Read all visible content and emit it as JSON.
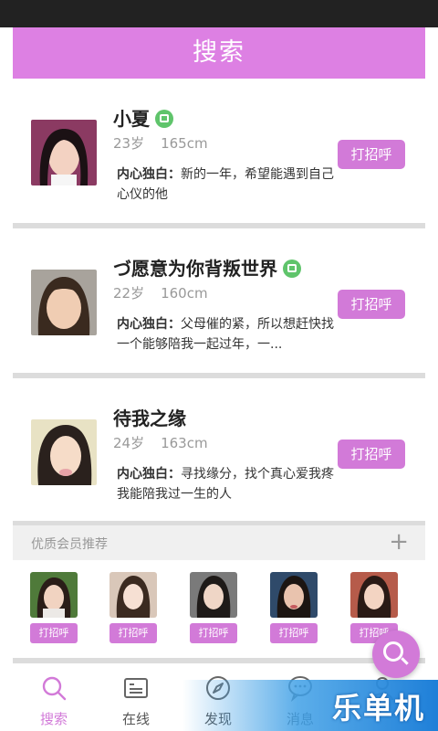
{
  "header": {
    "title": "搜索"
  },
  "colors": {
    "accent": "#dd80e3",
    "button": "#d27ad8",
    "verified": "#5fc46b"
  },
  "cards": [
    {
      "name": "小夏",
      "verified": true,
      "age": "23岁",
      "height": "165cm",
      "bio_label": "内心独白：",
      "bio": "新的一年，希望能遇到自己心仪的他",
      "button": "打招呼"
    },
    {
      "name": "づ愿意为你背叛世界",
      "verified": true,
      "age": "22岁",
      "height": "160cm",
      "bio_label": "内心独白：",
      "bio": "父母催的紧，所以想赶快找一个能够陪我一起过年，一...",
      "button": "打招呼"
    },
    {
      "name": "待我之缘",
      "verified": false,
      "age": "24岁",
      "height": "163cm",
      "bio_label": "内心独白：",
      "bio": "寻找缘分，找个真心爱我疼我能陪我过一生的人",
      "button": "打招呼"
    }
  ],
  "recommend": {
    "title": "优质会员推荐",
    "more_icon": "plus-icon",
    "items": [
      {
        "button": "打招呼"
      },
      {
        "button": "打招呼"
      },
      {
        "button": "打招呼"
      },
      {
        "button": "打招呼"
      },
      {
        "button": "打招呼"
      }
    ]
  },
  "tabs": [
    {
      "label": "搜索",
      "icon": "search-icon",
      "active": true
    },
    {
      "label": "在线",
      "icon": "id-card-icon",
      "active": false
    },
    {
      "label": "发现",
      "icon": "compass-icon",
      "active": false
    },
    {
      "label": "消息",
      "icon": "chat-icon",
      "active": false
    },
    {
      "label": "",
      "icon": "user-icon",
      "active": false
    }
  ],
  "fab": {
    "icon": "search-icon"
  },
  "watermark": {
    "text": "乐单机"
  }
}
